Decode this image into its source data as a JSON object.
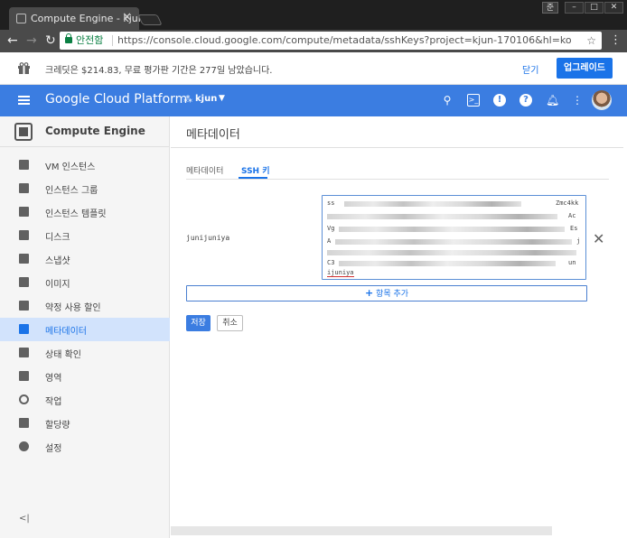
{
  "browser": {
    "tab_title": "Compute Engine - kjun",
    "profile_label": "준",
    "secure_label": "안전함",
    "url": "https://console.cloud.google.com/compute/metadata/sshKeys?project=kjun-170106&hl=ko"
  },
  "banner": {
    "text": "크레딧은 $214.83, 무료 평가판 기간은 277일 남았습니다.",
    "dismiss_label": "닫기",
    "upgrade_label": "업그레이드"
  },
  "header": {
    "product": "Google Cloud Platform",
    "project": "kjun"
  },
  "sidebar": {
    "title": "Compute Engine",
    "items": [
      {
        "label": "VM 인스턴스"
      },
      {
        "label": "인스턴스 그룹"
      },
      {
        "label": "인스턴스 템플릿"
      },
      {
        "label": "디스크"
      },
      {
        "label": "스냅샷"
      },
      {
        "label": "이미지"
      },
      {
        "label": "약정 사용 할인"
      },
      {
        "label": "메타데이터"
      },
      {
        "label": "상태 확인"
      },
      {
        "label": "영역"
      },
      {
        "label": "작업"
      },
      {
        "label": "할당량"
      },
      {
        "label": "설정"
      }
    ],
    "active_index": 7,
    "collapse_label": "<|"
  },
  "main": {
    "title": "메타데이터",
    "tabs": [
      {
        "label": "메타데이터"
      },
      {
        "label": "SSH 키"
      }
    ],
    "ssh_key": {
      "username": "junijuniya",
      "line1_start": "ss",
      "line1_end": "Zmc4kk",
      "line2_end": "Ac",
      "line3_start": "Vg",
      "line3_end": "Es",
      "line4_start": "A",
      "line4_end": "j",
      "line7_start": "C3",
      "line7_end": "un",
      "line8": "ijuniya"
    },
    "add_item_label": "항목 추가",
    "save_label": "저장",
    "cancel_label": "취소"
  }
}
